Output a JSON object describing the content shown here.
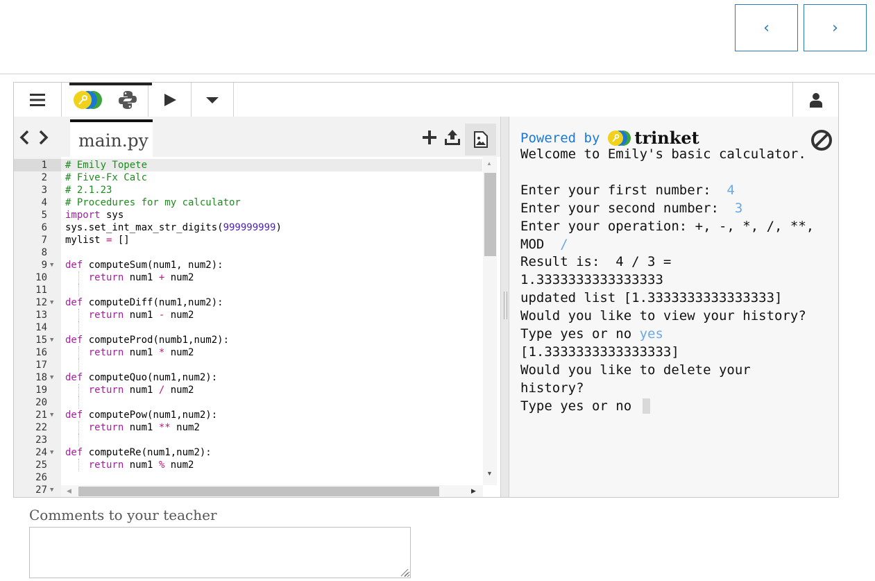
{
  "nav": {
    "prev_symbol": "‹",
    "next_symbol": "›"
  },
  "toolbar": {
    "menu_icon": "hamburger-menu-icon",
    "run_icon": "play-icon",
    "dropdown_icon": "caret-down-icon",
    "user_icon": "user-icon",
    "lang_icons": [
      "trinket-logo-icon",
      "python-logo-icon"
    ]
  },
  "editor": {
    "file_tab": "main.py",
    "nav_arrows": "<>",
    "icons": [
      "add-file-icon",
      "upload-icon",
      "image-icon"
    ],
    "lines": [
      {
        "n": "1",
        "fold": false,
        "active": true,
        "indent": false,
        "tokens": [
          {
            "t": "# Emily Topete",
            "c": "c-comment"
          }
        ]
      },
      {
        "n": "2",
        "fold": false,
        "indent": false,
        "tokens": [
          {
            "t": "# Five-Fx Calc",
            "c": "c-comment"
          }
        ]
      },
      {
        "n": "3",
        "fold": false,
        "indent": false,
        "tokens": [
          {
            "t": "# 2.1.23",
            "c": "c-comment"
          }
        ]
      },
      {
        "n": "4",
        "fold": false,
        "indent": false,
        "tokens": [
          {
            "t": "# Procedures for my calculator",
            "c": "c-comment"
          }
        ]
      },
      {
        "n": "5",
        "fold": false,
        "indent": false,
        "tokens": [
          {
            "t": "import",
            "c": "c-kw"
          },
          {
            "t": " sys",
            "c": ""
          }
        ]
      },
      {
        "n": "6",
        "fold": false,
        "indent": false,
        "tokens": [
          {
            "t": "sys.set_int_max_str_digits(",
            "c": ""
          },
          {
            "t": "999999999",
            "c": "c-num"
          },
          {
            "t": ")",
            "c": ""
          }
        ]
      },
      {
        "n": "7",
        "fold": false,
        "indent": false,
        "tokens": [
          {
            "t": "mylist ",
            "c": ""
          },
          {
            "t": "=",
            "c": "c-op"
          },
          {
            "t": " []",
            "c": ""
          }
        ]
      },
      {
        "n": "8",
        "fold": false,
        "indent": false,
        "tokens": []
      },
      {
        "n": "9",
        "fold": true,
        "indent": false,
        "tokens": [
          {
            "t": "def",
            "c": "c-kw"
          },
          {
            "t": " computeSum(num1, num2):",
            "c": ""
          }
        ]
      },
      {
        "n": "10",
        "fold": false,
        "indent": true,
        "tokens": [
          {
            "t": "    ",
            "c": ""
          },
          {
            "t": "return",
            "c": "c-kw"
          },
          {
            "t": " num1 ",
            "c": ""
          },
          {
            "t": "+",
            "c": "c-op"
          },
          {
            "t": " num2",
            "c": ""
          }
        ]
      },
      {
        "n": "11",
        "fold": false,
        "indent": true,
        "tokens": []
      },
      {
        "n": "12",
        "fold": true,
        "indent": false,
        "tokens": [
          {
            "t": "def",
            "c": "c-kw"
          },
          {
            "t": " computeDiff(num1,num2):",
            "c": ""
          }
        ]
      },
      {
        "n": "13",
        "fold": false,
        "indent": true,
        "tokens": [
          {
            "t": "    ",
            "c": ""
          },
          {
            "t": "return",
            "c": "c-kw"
          },
          {
            "t": " num1 ",
            "c": ""
          },
          {
            "t": "-",
            "c": "c-op"
          },
          {
            "t": " num2",
            "c": ""
          }
        ]
      },
      {
        "n": "14",
        "fold": false,
        "indent": true,
        "tokens": []
      },
      {
        "n": "15",
        "fold": true,
        "indent": false,
        "tokens": [
          {
            "t": "def",
            "c": "c-kw"
          },
          {
            "t": " computeProd(numb1,num2):",
            "c": ""
          }
        ]
      },
      {
        "n": "16",
        "fold": false,
        "indent": true,
        "tokens": [
          {
            "t": "    ",
            "c": ""
          },
          {
            "t": "return",
            "c": "c-kw"
          },
          {
            "t": " num1 ",
            "c": ""
          },
          {
            "t": "*",
            "c": "c-op"
          },
          {
            "t": " num2",
            "c": ""
          }
        ]
      },
      {
        "n": "17",
        "fold": false,
        "indent": true,
        "tokens": []
      },
      {
        "n": "18",
        "fold": true,
        "indent": false,
        "tokens": [
          {
            "t": "def",
            "c": "c-kw"
          },
          {
            "t": " computeQuo(num1,num2):",
            "c": ""
          }
        ]
      },
      {
        "n": "19",
        "fold": false,
        "indent": true,
        "tokens": [
          {
            "t": "    ",
            "c": ""
          },
          {
            "t": "return",
            "c": "c-kw"
          },
          {
            "t": " num1 ",
            "c": ""
          },
          {
            "t": "/",
            "c": "c-op"
          },
          {
            "t": " num2",
            "c": ""
          }
        ]
      },
      {
        "n": "20",
        "fold": false,
        "indent": true,
        "tokens": []
      },
      {
        "n": "21",
        "fold": true,
        "indent": false,
        "tokens": [
          {
            "t": "def",
            "c": "c-kw"
          },
          {
            "t": " computePow(num1,num2):",
            "c": ""
          }
        ]
      },
      {
        "n": "22",
        "fold": false,
        "indent": true,
        "tokens": [
          {
            "t": "    ",
            "c": ""
          },
          {
            "t": "return",
            "c": "c-kw"
          },
          {
            "t": " num1 ",
            "c": ""
          },
          {
            "t": "**",
            "c": "c-op"
          },
          {
            "t": " num2",
            "c": ""
          }
        ]
      },
      {
        "n": "23",
        "fold": false,
        "indent": true,
        "tokens": []
      },
      {
        "n": "24",
        "fold": true,
        "indent": false,
        "tokens": [
          {
            "t": "def",
            "c": "c-kw"
          },
          {
            "t": " computeRe(num1,num2):",
            "c": ""
          }
        ]
      },
      {
        "n": "25",
        "fold": false,
        "indent": true,
        "tokens": [
          {
            "t": "    ",
            "c": ""
          },
          {
            "t": "return",
            "c": "c-kw"
          },
          {
            "t": " num1 ",
            "c": ""
          },
          {
            "t": "%",
            "c": "c-op"
          },
          {
            "t": " num2",
            "c": ""
          }
        ]
      },
      {
        "n": "26",
        "fold": false,
        "indent": false,
        "tokens": []
      },
      {
        "n": "27",
        "fold": true,
        "indent": false,
        "tokens": []
      }
    ]
  },
  "output": {
    "powered_by": "Powered by",
    "brand": "trinket",
    "stop_icon": "stop-icon",
    "lines": [
      [
        {
          "t": "Welcome to Emily's basic calculator.",
          "c": ""
        }
      ],
      [],
      [
        {
          "t": "Enter your first number:  ",
          "c": ""
        },
        {
          "t": "4",
          "c": "inp"
        }
      ],
      [
        {
          "t": "Enter your second number:  ",
          "c": ""
        },
        {
          "t": "3",
          "c": "inp"
        }
      ],
      [
        {
          "t": "Enter your operation: +, -, *, /, **,",
          "c": ""
        }
      ],
      [
        {
          "t": "MOD  ",
          "c": ""
        },
        {
          "t": "/",
          "c": "inp"
        }
      ],
      [
        {
          "t": "Result is:  4 / 3 =",
          "c": ""
        }
      ],
      [
        {
          "t": "1.3333333333333333",
          "c": ""
        }
      ],
      [
        {
          "t": "updated list [1.3333333333333333]",
          "c": ""
        }
      ],
      [
        {
          "t": "Would you like to view your history?",
          "c": ""
        }
      ],
      [
        {
          "t": "Type yes or no ",
          "c": ""
        },
        {
          "t": "yes",
          "c": "inp"
        }
      ],
      [
        {
          "t": "[1.3333333333333333]",
          "c": ""
        }
      ],
      [
        {
          "t": "Would you like to delete your",
          "c": ""
        }
      ],
      [
        {
          "t": "history?",
          "c": ""
        }
      ],
      [
        {
          "t": "Type yes or no ",
          "c": ""
        },
        {
          "t": "",
          "c": "cursor"
        }
      ]
    ]
  },
  "comments": {
    "label": "Comments to your teacher",
    "value": "",
    "resize_icon": "resize-handle-icon"
  }
}
